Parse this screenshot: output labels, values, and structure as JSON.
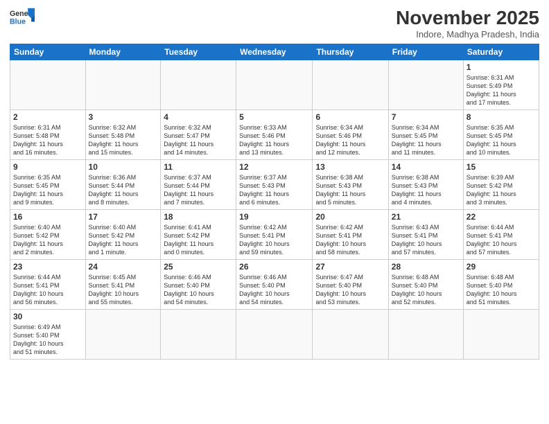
{
  "logo": {
    "text_general": "General",
    "text_blue": "Blue"
  },
  "title": "November 2025",
  "subtitle": "Indore, Madhya Pradesh, India",
  "days_of_week": [
    "Sunday",
    "Monday",
    "Tuesday",
    "Wednesday",
    "Thursday",
    "Friday",
    "Saturday"
  ],
  "weeks": [
    [
      {
        "day": "",
        "info": ""
      },
      {
        "day": "",
        "info": ""
      },
      {
        "day": "",
        "info": ""
      },
      {
        "day": "",
        "info": ""
      },
      {
        "day": "",
        "info": ""
      },
      {
        "day": "",
        "info": ""
      },
      {
        "day": "1",
        "info": "Sunrise: 6:31 AM\nSunset: 5:49 PM\nDaylight: 11 hours\nand 17 minutes."
      }
    ],
    [
      {
        "day": "2",
        "info": "Sunrise: 6:31 AM\nSunset: 5:48 PM\nDaylight: 11 hours\nand 16 minutes."
      },
      {
        "day": "3",
        "info": "Sunrise: 6:32 AM\nSunset: 5:48 PM\nDaylight: 11 hours\nand 15 minutes."
      },
      {
        "day": "4",
        "info": "Sunrise: 6:32 AM\nSunset: 5:47 PM\nDaylight: 11 hours\nand 14 minutes."
      },
      {
        "day": "5",
        "info": "Sunrise: 6:33 AM\nSunset: 5:46 PM\nDaylight: 11 hours\nand 13 minutes."
      },
      {
        "day": "6",
        "info": "Sunrise: 6:34 AM\nSunset: 5:46 PM\nDaylight: 11 hours\nand 12 minutes."
      },
      {
        "day": "7",
        "info": "Sunrise: 6:34 AM\nSunset: 5:45 PM\nDaylight: 11 hours\nand 11 minutes."
      },
      {
        "day": "8",
        "info": "Sunrise: 6:35 AM\nSunset: 5:45 PM\nDaylight: 11 hours\nand 10 minutes."
      }
    ],
    [
      {
        "day": "9",
        "info": "Sunrise: 6:35 AM\nSunset: 5:45 PM\nDaylight: 11 hours\nand 9 minutes."
      },
      {
        "day": "10",
        "info": "Sunrise: 6:36 AM\nSunset: 5:44 PM\nDaylight: 11 hours\nand 8 minutes."
      },
      {
        "day": "11",
        "info": "Sunrise: 6:37 AM\nSunset: 5:44 PM\nDaylight: 11 hours\nand 7 minutes."
      },
      {
        "day": "12",
        "info": "Sunrise: 6:37 AM\nSunset: 5:43 PM\nDaylight: 11 hours\nand 6 minutes."
      },
      {
        "day": "13",
        "info": "Sunrise: 6:38 AM\nSunset: 5:43 PM\nDaylight: 11 hours\nand 5 minutes."
      },
      {
        "day": "14",
        "info": "Sunrise: 6:38 AM\nSunset: 5:43 PM\nDaylight: 11 hours\nand 4 minutes."
      },
      {
        "day": "15",
        "info": "Sunrise: 6:39 AM\nSunset: 5:42 PM\nDaylight: 11 hours\nand 3 minutes."
      }
    ],
    [
      {
        "day": "16",
        "info": "Sunrise: 6:40 AM\nSunset: 5:42 PM\nDaylight: 11 hours\nand 2 minutes."
      },
      {
        "day": "17",
        "info": "Sunrise: 6:40 AM\nSunset: 5:42 PM\nDaylight: 11 hours\nand 1 minute."
      },
      {
        "day": "18",
        "info": "Sunrise: 6:41 AM\nSunset: 5:42 PM\nDaylight: 11 hours\nand 0 minutes."
      },
      {
        "day": "19",
        "info": "Sunrise: 6:42 AM\nSunset: 5:41 PM\nDaylight: 10 hours\nand 59 minutes."
      },
      {
        "day": "20",
        "info": "Sunrise: 6:42 AM\nSunset: 5:41 PM\nDaylight: 10 hours\nand 58 minutes."
      },
      {
        "day": "21",
        "info": "Sunrise: 6:43 AM\nSunset: 5:41 PM\nDaylight: 10 hours\nand 57 minutes."
      },
      {
        "day": "22",
        "info": "Sunrise: 6:44 AM\nSunset: 5:41 PM\nDaylight: 10 hours\nand 57 minutes."
      }
    ],
    [
      {
        "day": "23",
        "info": "Sunrise: 6:44 AM\nSunset: 5:41 PM\nDaylight: 10 hours\nand 56 minutes."
      },
      {
        "day": "24",
        "info": "Sunrise: 6:45 AM\nSunset: 5:41 PM\nDaylight: 10 hours\nand 55 minutes."
      },
      {
        "day": "25",
        "info": "Sunrise: 6:46 AM\nSunset: 5:40 PM\nDaylight: 10 hours\nand 54 minutes."
      },
      {
        "day": "26",
        "info": "Sunrise: 6:46 AM\nSunset: 5:40 PM\nDaylight: 10 hours\nand 54 minutes."
      },
      {
        "day": "27",
        "info": "Sunrise: 6:47 AM\nSunset: 5:40 PM\nDaylight: 10 hours\nand 53 minutes."
      },
      {
        "day": "28",
        "info": "Sunrise: 6:48 AM\nSunset: 5:40 PM\nDaylight: 10 hours\nand 52 minutes."
      },
      {
        "day": "29",
        "info": "Sunrise: 6:48 AM\nSunset: 5:40 PM\nDaylight: 10 hours\nand 51 minutes."
      }
    ],
    [
      {
        "day": "30",
        "info": "Sunrise: 6:49 AM\nSunset: 5:40 PM\nDaylight: 10 hours\nand 51 minutes."
      },
      {
        "day": "",
        "info": ""
      },
      {
        "day": "",
        "info": ""
      },
      {
        "day": "",
        "info": ""
      },
      {
        "day": "",
        "info": ""
      },
      {
        "day": "",
        "info": ""
      },
      {
        "day": "",
        "info": ""
      }
    ]
  ]
}
